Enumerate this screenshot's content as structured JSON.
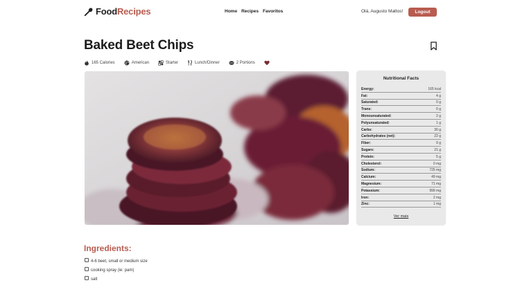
{
  "header": {
    "logo_main": "Food",
    "logo_accent": "Recipes",
    "nav": [
      "Home",
      "Recipes",
      "Favoritos"
    ],
    "greeting": "Olá, Augusto Mattos!",
    "logout_label": "Logout"
  },
  "recipe": {
    "title": "Baked Beet Chips",
    "meta": {
      "calories": "165 Calories",
      "cuisine": "American",
      "course": "Starter",
      "meal": "Lunch/Dinner",
      "portions": "2 Portions"
    }
  },
  "nutrition": {
    "title": "Nutritional Facts",
    "rows": [
      {
        "label": "Energy:",
        "value": "165 kcal"
      },
      {
        "label": "Fat:",
        "value": "4 g"
      },
      {
        "label": "Saturated:",
        "value": "0 g"
      },
      {
        "label": "Trans:",
        "value": "0 g"
      },
      {
        "label": "Monounsaturated:",
        "value": "2 g"
      },
      {
        "label": "Polyunsaturated:",
        "value": "1 g"
      },
      {
        "label": "Carbs:",
        "value": "30 g"
      },
      {
        "label": "Carbohydrates (net):",
        "value": "22 g"
      },
      {
        "label": "Fiber:",
        "value": "9 g"
      },
      {
        "label": "Sugars:",
        "value": "21 g"
      },
      {
        "label": "Protein:",
        "value": "5 g"
      },
      {
        "label": "Cholesterol:",
        "value": "0 mg"
      },
      {
        "label": "Sodium:",
        "value": "725 mg"
      },
      {
        "label": "Calcium:",
        "value": "49 mg"
      },
      {
        "label": "Magnesium:",
        "value": "71 mg"
      },
      {
        "label": "Potassium:",
        "value": "999 mg"
      },
      {
        "label": "Iron:",
        "value": "2 mg"
      },
      {
        "label": "Zinc:",
        "value": "1 mg"
      }
    ],
    "see_more": "Ver mais"
  },
  "ingredients": {
    "title": "Ingredients:",
    "items": [
      "4-6 beet, small or medium size",
      "cooking spray (ie: pam)",
      "salt"
    ]
  },
  "colors": {
    "accent": "#b85c50",
    "panel_bg": "#e9e9e9"
  },
  "icons": [
    "chef-spoon-icon",
    "fire-icon",
    "globe-icon",
    "starter-icon",
    "cutlery-icon",
    "portions-icon",
    "heart-icon",
    "bookmark-icon"
  ]
}
